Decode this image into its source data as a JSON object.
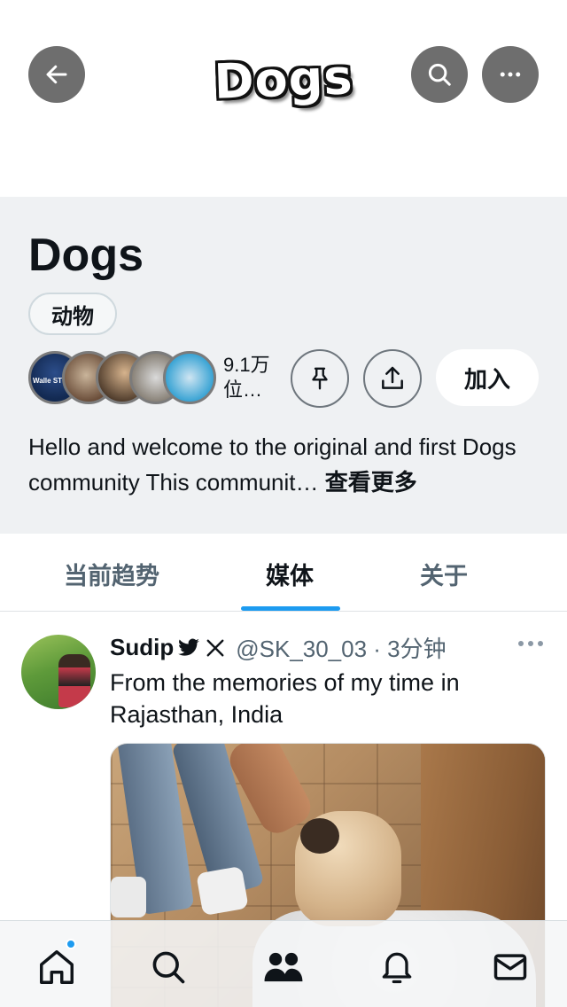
{
  "header": {
    "logo_text": "Dogs",
    "icons": {
      "back": "arrow-left-icon",
      "search": "search-icon",
      "more": "more-horizontal-icon"
    }
  },
  "community": {
    "name": "Dogs",
    "category": "动物",
    "members": "9.1万位…",
    "join_label": "加入",
    "description": "Hello and welcome to the original and first Dogs community This communit…",
    "see_more": "查看更多",
    "first_avatar_text": "Walle STRONG",
    "icons": {
      "pin": "pin-icon",
      "share": "share-icon"
    }
  },
  "tabs": [
    {
      "label": "当前趋势",
      "active": false
    },
    {
      "label": "媒体",
      "active": true
    },
    {
      "label": "关于",
      "active": false
    }
  ],
  "post": {
    "author": "Sudip",
    "handle": "@SK_30_03 · 3分钟",
    "text": "From the memories of my time in Rajasthan, India",
    "icons": {
      "badge": "twitter-bird-icon",
      "x": "x-logo-icon",
      "more": "more-horizontal-icon"
    }
  },
  "bottom_nav": [
    {
      "name": "home",
      "icon": "home-icon",
      "has_badge": true
    },
    {
      "name": "search",
      "icon": "search-icon"
    },
    {
      "name": "communities",
      "icon": "communities-icon"
    },
    {
      "name": "notifications",
      "icon": "bell-icon"
    },
    {
      "name": "messages",
      "icon": "mail-icon"
    }
  ],
  "colors": {
    "accent": "#1d9bf0",
    "text_primary": "#0f1419",
    "text_secondary": "#536471",
    "panel_bg": "#eff1f3",
    "header_button_bg": "#6e6e6e"
  }
}
